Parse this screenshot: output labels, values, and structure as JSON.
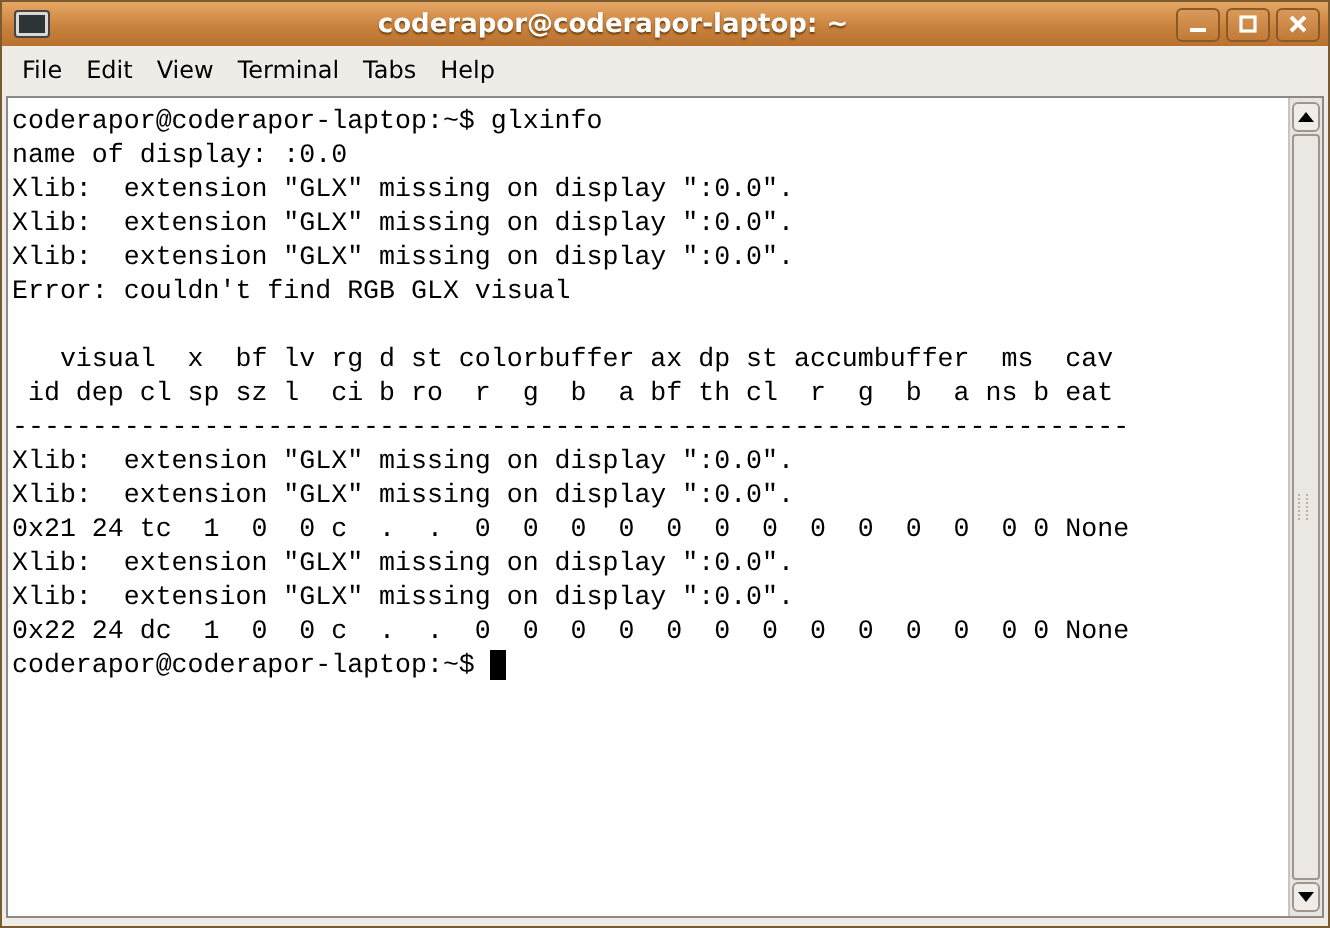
{
  "window": {
    "title": "coderapor@coderapor-laptop: ~"
  },
  "menu": [
    "File",
    "Edit",
    "View",
    "Terminal",
    "Tabs",
    "Help"
  ],
  "terminal": {
    "lines": [
      {
        "kind": "text",
        "text": "coderapor@coderapor-laptop:~$ glxinfo"
      },
      {
        "kind": "text",
        "text": "name of display: :0.0"
      },
      {
        "kind": "text",
        "text": "Xlib:  extension \"GLX\" missing on display \":0.0\"."
      },
      {
        "kind": "text",
        "text": "Xlib:  extension \"GLX\" missing on display \":0.0\"."
      },
      {
        "kind": "text",
        "text": "Xlib:  extension \"GLX\" missing on display \":0.0\"."
      },
      {
        "kind": "text",
        "text": "Error: couldn't find RGB GLX visual"
      },
      {
        "kind": "blank"
      },
      {
        "kind": "text",
        "text": "   visual  x  bf lv rg d st colorbuffer ax dp st accumbuffer  ms  cav"
      },
      {
        "kind": "text",
        "text": " id dep cl sp sz l  ci b ro  r  g  b  a bf th cl  r  g  b  a ns b eat"
      },
      {
        "kind": "text",
        "text": "----------------------------------------------------------------------"
      },
      {
        "kind": "text",
        "text": "Xlib:  extension \"GLX\" missing on display \":0.0\"."
      },
      {
        "kind": "text",
        "text": "Xlib:  extension \"GLX\" missing on display \":0.0\"."
      },
      {
        "kind": "text",
        "text": "0x21 24 tc  1  0  0 c  .  .  0  0  0  0  0  0  0  0  0  0  0  0 0 None"
      },
      {
        "kind": "text",
        "text": "Xlib:  extension \"GLX\" missing on display \":0.0\"."
      },
      {
        "kind": "text",
        "text": "Xlib:  extension \"GLX\" missing on display \":0.0\"."
      },
      {
        "kind": "text",
        "text": "0x22 24 dc  1  0  0 c  .  .  0  0  0  0  0  0  0  0  0  0  0  0 0 None"
      },
      {
        "kind": "prompt",
        "text": "coderapor@coderapor-laptop:~$ "
      }
    ]
  }
}
